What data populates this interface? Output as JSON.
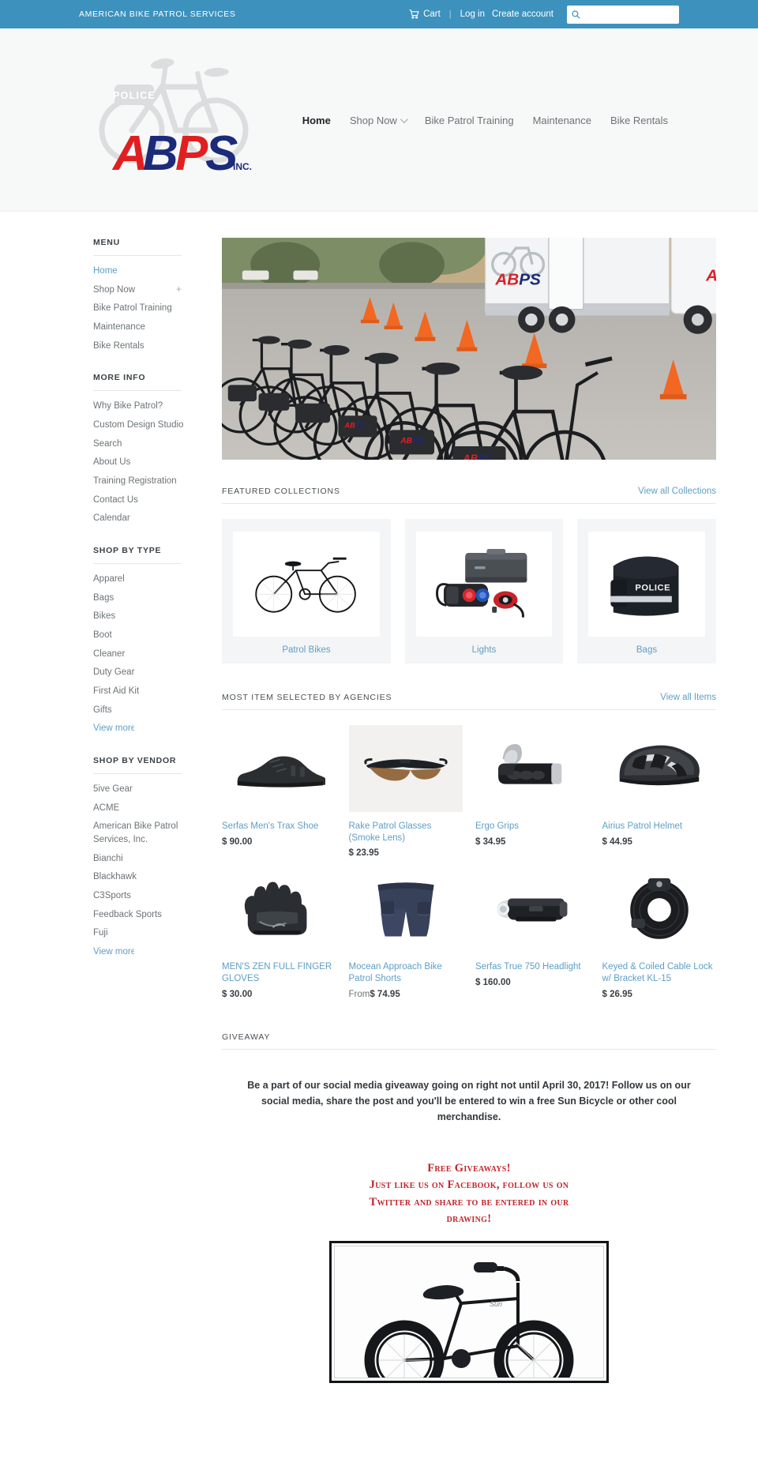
{
  "topbar": {
    "site_title": "AMERICAN BIKE PATROL SERVICES",
    "cart_label": "Cart",
    "cart_icon": "shopping-cart-icon",
    "separator": "|",
    "login_label": "Log in",
    "create_account_label": "Create account",
    "search_placeholder": "",
    "search_value": "",
    "search_icon": "search-icon",
    "background_color": "#3d91bd"
  },
  "header": {
    "logo_alt": "ABPS American Bike Patrol Services logo",
    "logo_badge": "POLICE",
    "logo_word": "ABPS",
    "logo_sub": "INC.",
    "nav": [
      {
        "label": "Home",
        "active": true,
        "has_dropdown": false
      },
      {
        "label": "Shop Now",
        "active": false,
        "has_dropdown": true
      },
      {
        "label": "Bike Patrol Training",
        "active": false,
        "has_dropdown": false
      },
      {
        "label": "Maintenance",
        "active": false,
        "has_dropdown": false
      },
      {
        "label": "Bike Rentals",
        "active": false,
        "has_dropdown": false
      }
    ]
  },
  "sidebar": {
    "menu": {
      "title": "MENU",
      "items": [
        {
          "label": "Home",
          "active": true,
          "expander": ""
        },
        {
          "label": "Shop Now",
          "active": false,
          "expander": "+"
        },
        {
          "label": "Bike Patrol Training",
          "active": false,
          "expander": ""
        },
        {
          "label": "Maintenance",
          "active": false,
          "expander": ""
        },
        {
          "label": "Bike Rentals",
          "active": false,
          "expander": ""
        }
      ]
    },
    "more_info": {
      "title": "MORE INFO",
      "items": [
        {
          "label": "Why Bike Patrol?"
        },
        {
          "label": "Custom Design Studio"
        },
        {
          "label": "Search"
        },
        {
          "label": "About Us"
        },
        {
          "label": "Training Registration"
        },
        {
          "label": "Contact Us"
        },
        {
          "label": "Calendar"
        }
      ]
    },
    "shop_by_type": {
      "title": "SHOP BY TYPE",
      "items": [
        {
          "label": "Apparel"
        },
        {
          "label": "Bags"
        },
        {
          "label": "Bikes"
        },
        {
          "label": "Boot"
        },
        {
          "label": "Cleaner"
        },
        {
          "label": "Duty Gear"
        },
        {
          "label": "First Aid Kit"
        },
        {
          "label": "Gifts"
        }
      ],
      "view_more": "View more"
    },
    "shop_by_vendor": {
      "title": "SHOP BY VENDOR",
      "items": [
        {
          "label": "5ive Gear"
        },
        {
          "label": "ACME"
        },
        {
          "label": "American Bike Patrol Services, Inc."
        },
        {
          "label": "Bianchi"
        },
        {
          "label": "Blackhawk"
        },
        {
          "label": "C3Sports"
        },
        {
          "label": "Feedback Sports"
        },
        {
          "label": "Fuji"
        }
      ],
      "view_more": "View more"
    }
  },
  "hero": {
    "alt": "Row of black ABPS patrol bicycles in a parking lot with white ABPS trailer, van and orange traffic cones"
  },
  "featured_collections": {
    "title": "FEATURED COLLECTIONS",
    "view_all_label": "View all Collections",
    "items": [
      {
        "label": "Patrol Bikes",
        "image_alt": "black hybrid patrol bicycle"
      },
      {
        "label": "Lights",
        "image_alt": "bike light set with hard case"
      },
      {
        "label": "Bags",
        "image_alt": "black POLICE rear rack trunk bag"
      }
    ]
  },
  "most_items": {
    "title": "MOST ITEM SELECTED BY AGENCIES",
    "view_all_label": "View all Items",
    "products": [
      {
        "title": "Serfas Men's Trax Shoe",
        "price_prefix": "",
        "price": "$ 90.00",
        "image_alt": "black cycling shoe"
      },
      {
        "title": "Rake Patrol Glasses (Smoke Lens)",
        "price_prefix": "",
        "price": "$ 23.95",
        "image_alt": "sport sunglasses with smoke lens"
      },
      {
        "title": "Ergo Grips",
        "price_prefix": "",
        "price": "$ 34.95",
        "image_alt": "ergonomic bicycle handlebar grip"
      },
      {
        "title": "Airius Patrol Helmet",
        "price_prefix": "",
        "price": "$ 44.95",
        "image_alt": "black and silver bike helmet"
      },
      {
        "title": "MEN'S ZEN FULL FINGER GLOVES",
        "price_prefix": "",
        "price": "$ 30.00",
        "image_alt": "black full finger cycling gloves"
      },
      {
        "title": "Mocean Approach Bike Patrol Shorts",
        "price_prefix": "From",
        "price": "$ 74.95",
        "image_alt": "navy blue bike patrol shorts"
      },
      {
        "title": "Serfas True 750 Headlight",
        "price_prefix": "",
        "price": "$ 160.00",
        "image_alt": "black cylindrical bicycle headlight"
      },
      {
        "title": "Keyed & Coiled Cable Lock w/ Bracket KL-15",
        "price_prefix": "",
        "price": "$ 26.95",
        "image_alt": "coiled black cable bike lock"
      }
    ]
  },
  "giveaway": {
    "title": "GIVEAWAY",
    "body": "Be a part of our social media giveaway going on right not until April 30, 2017! Follow us on our social media, share the post and you'll be entered to win a free Sun Bicycle or other cool merchandise.",
    "promo_color": "#c0252b",
    "promo_lines": [
      "Free Giveaways!",
      "Just like us on Facebook, follow us on",
      "Twitter and share to be entered in our",
      "drawing!"
    ],
    "photo_alt": "Black Sun cruiser bicycle in a black picture frame"
  }
}
